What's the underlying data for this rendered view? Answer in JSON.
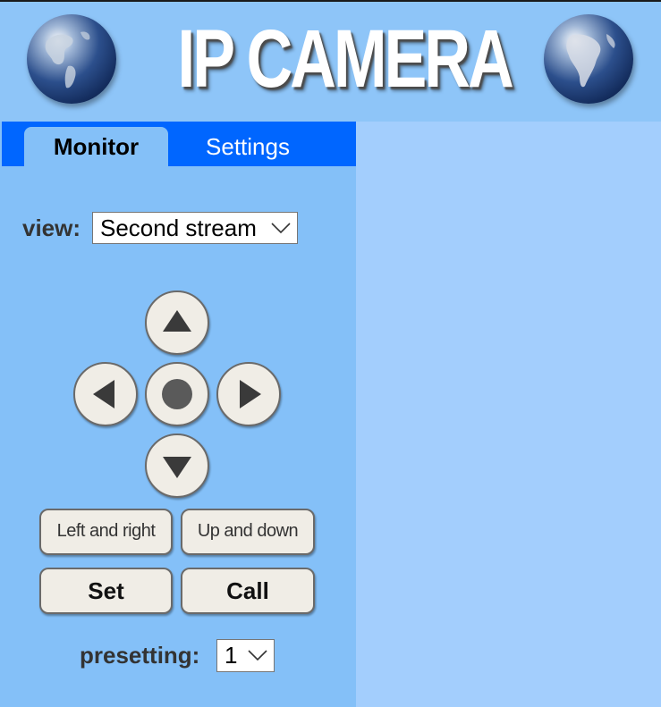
{
  "header": {
    "title": "IP CAMERA",
    "left_icon": "globe-americas-icon",
    "right_icon": "globe-south-america-icon"
  },
  "tabs": [
    {
      "label": "Monitor",
      "active": true
    },
    {
      "label": "Settings",
      "active": false
    }
  ],
  "view": {
    "label": "view:",
    "selected": "Second stream"
  },
  "ptz": {
    "up_icon": "arrow-up-icon",
    "left_icon": "arrow-left-icon",
    "center_icon": "stop-circle-icon",
    "right_icon": "arrow-right-icon",
    "down_icon": "arrow-down-icon",
    "left_right_label": "Left and right",
    "up_down_label": "Up and down",
    "set_label": "Set",
    "call_label": "Call"
  },
  "presetting": {
    "label": "presetting:",
    "selected": "1"
  },
  "colors": {
    "header_bg": "#8ec5f8",
    "sidebar_bg": "#84c0f8",
    "main_bg": "#a3cefd",
    "tab_bar": "#0066ff",
    "button_face": "#f0ede6"
  }
}
